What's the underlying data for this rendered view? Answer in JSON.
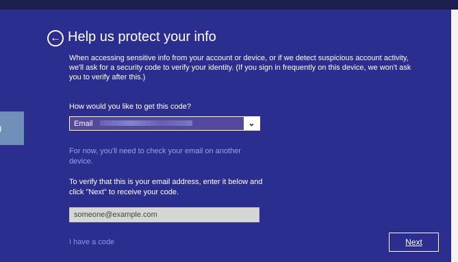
{
  "window": {
    "background_color": "#2b2e8f",
    "side_tab_text": ")"
  },
  "header": {
    "back_icon_glyph": "←",
    "title": "Help us protect your info"
  },
  "content": {
    "intro_text": "When accessing sensitive info from your account or device, or if we detect suspicious account activity, we'll ask for a security code to verify your identity. (If you sign in frequently on this device, we won't ask you to verify after this.)",
    "method_question": "How would you like to get this code?",
    "method_select": {
      "selected_value": "Email",
      "button_glyph": "⌄"
    },
    "delivery_note": "For now, you'll need to check your email on another device.",
    "verify_instruction": "To verify that this is your email address, enter it below and click \"Next\" to receive your code.",
    "email_input": {
      "value": "",
      "placeholder": "someone@example.com"
    },
    "code_link": "I have a code"
  },
  "footer": {
    "next_button": "Next"
  }
}
